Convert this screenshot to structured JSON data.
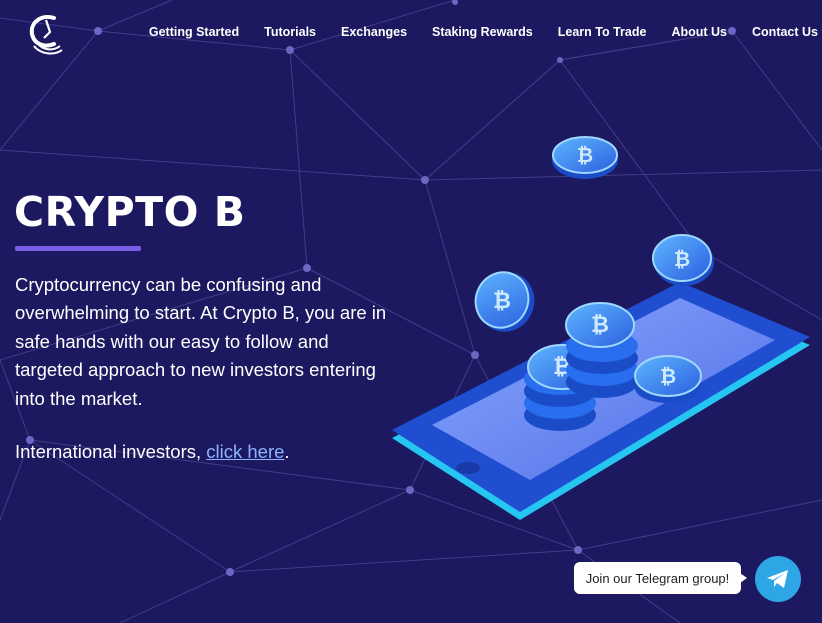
{
  "nav": {
    "items": [
      "Getting Started",
      "Tutorials",
      "Exchanges",
      "Staking Rewards",
      "Learn To Trade",
      "About Us",
      "Contact Us"
    ]
  },
  "hero": {
    "title": "CRYPTO B",
    "body": "Cryptocurrency can be confusing and overwhelming to start. At Crypto B, you are in safe hands with our easy to follow and targeted approach to new investors entering into the market.",
    "intl_prefix": "International investors, ",
    "intl_link": "click here",
    "intl_suffix": "."
  },
  "telegram": {
    "label": "Join our Telegram group!"
  },
  "colors": {
    "background": "#1c1960",
    "accent": "#7a5ee8",
    "link": "#8eb3ff",
    "telegram": "#2ea6e6"
  },
  "icons": [
    "brand-logo-icon",
    "bitcoin-coin-icon",
    "telegram-plane-icon"
  ]
}
